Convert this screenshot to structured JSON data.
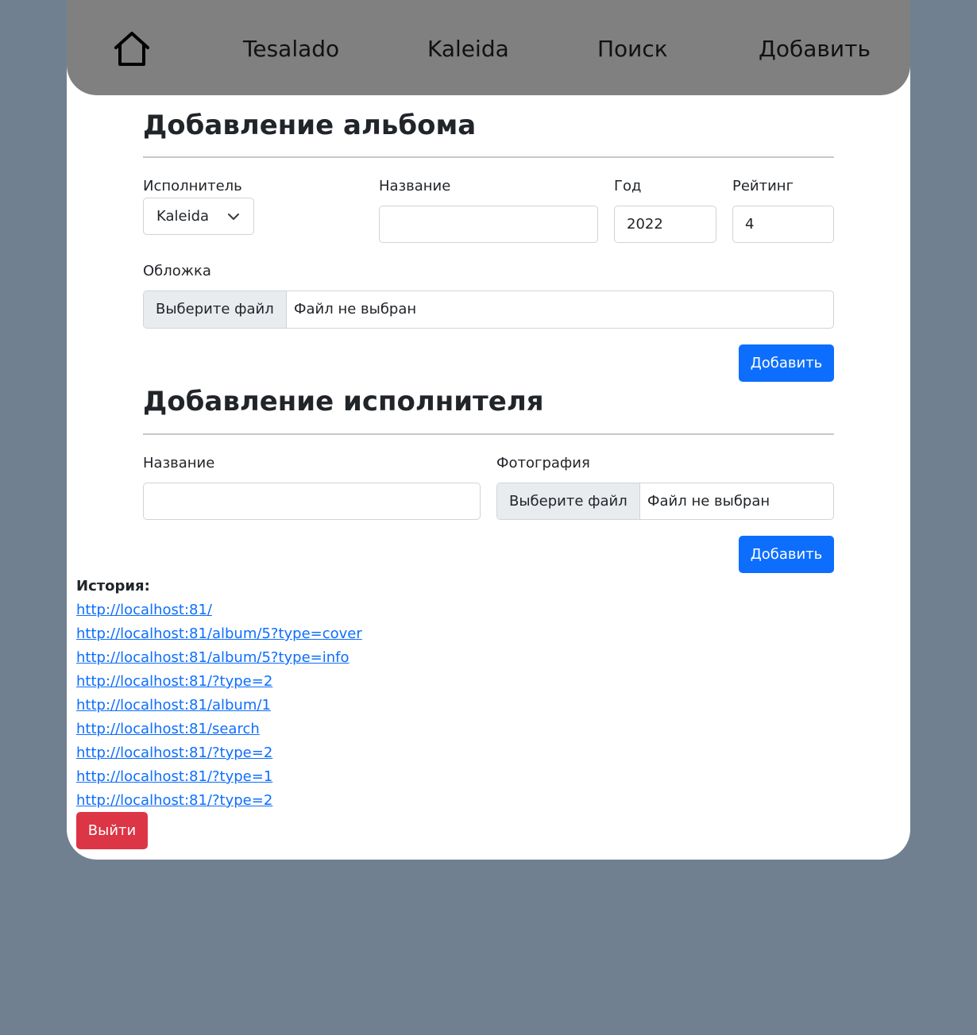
{
  "nav": {
    "home_icon": "home-icon",
    "links": [
      "Tesalado",
      "Kaleida",
      "Поиск",
      "Добавить"
    ]
  },
  "album_form": {
    "title": "Добавление альбома",
    "artist_label": "Исполнитель",
    "artist_value": "Kaleida",
    "name_label": "Название",
    "name_value": "",
    "year_label": "Год",
    "year_value": "2022",
    "rating_label": "Рейтинг",
    "rating_value": "4",
    "cover_label": "Обложка",
    "file_button": "Выберите файл",
    "file_status": "Файл не выбран",
    "submit": "Добавить"
  },
  "artist_form": {
    "title": "Добавление исполнителя",
    "name_label": "Название",
    "name_value": "",
    "photo_label": "Фотография",
    "file_button": "Выберите файл",
    "file_status": "Файл не выбран",
    "submit": "Добавить"
  },
  "history": {
    "title": "История:",
    "links": [
      "http://localhost:81/",
      "http://localhost:81/album/5?type=cover",
      "http://localhost:81/album/5?type=info",
      "http://localhost:81/?type=2",
      "http://localhost:81/album/1",
      "http://localhost:81/search",
      "http://localhost:81/?type=2",
      "http://localhost:81/?type=1",
      "http://localhost:81/?type=2"
    ]
  },
  "logout": "Выйти",
  "colors": {
    "page_bg": "#708090",
    "navbar_bg": "#808080",
    "primary": "#0d6efd",
    "danger": "#dc3545"
  }
}
